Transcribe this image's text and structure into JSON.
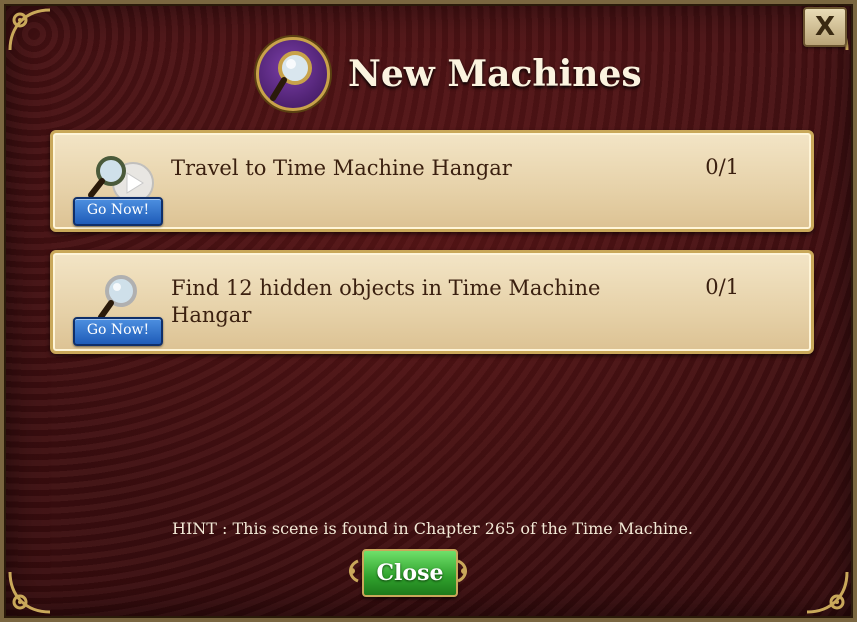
{
  "dialog": {
    "title": "New Machines",
    "close_x_label": "X"
  },
  "tasks": [
    {
      "text": "Travel to Time Machine Hangar",
      "count": "0/1",
      "button": "Go Now!",
      "icon": "magnifier-play-icon"
    },
    {
      "text": "Find 12 hidden objects in Time Machine Hangar",
      "count": "0/1",
      "button": "Go Now!",
      "icon": "magnifier-icon"
    }
  ],
  "hint": "HINT : This scene is found in Chapter 265 of the Time Machine.",
  "close_label": "Close",
  "colors": {
    "accent_gold": "#c9a85a",
    "go_button": "#1f5cb8",
    "close_button": "#2fa02c",
    "background": "#3a0d0f"
  }
}
